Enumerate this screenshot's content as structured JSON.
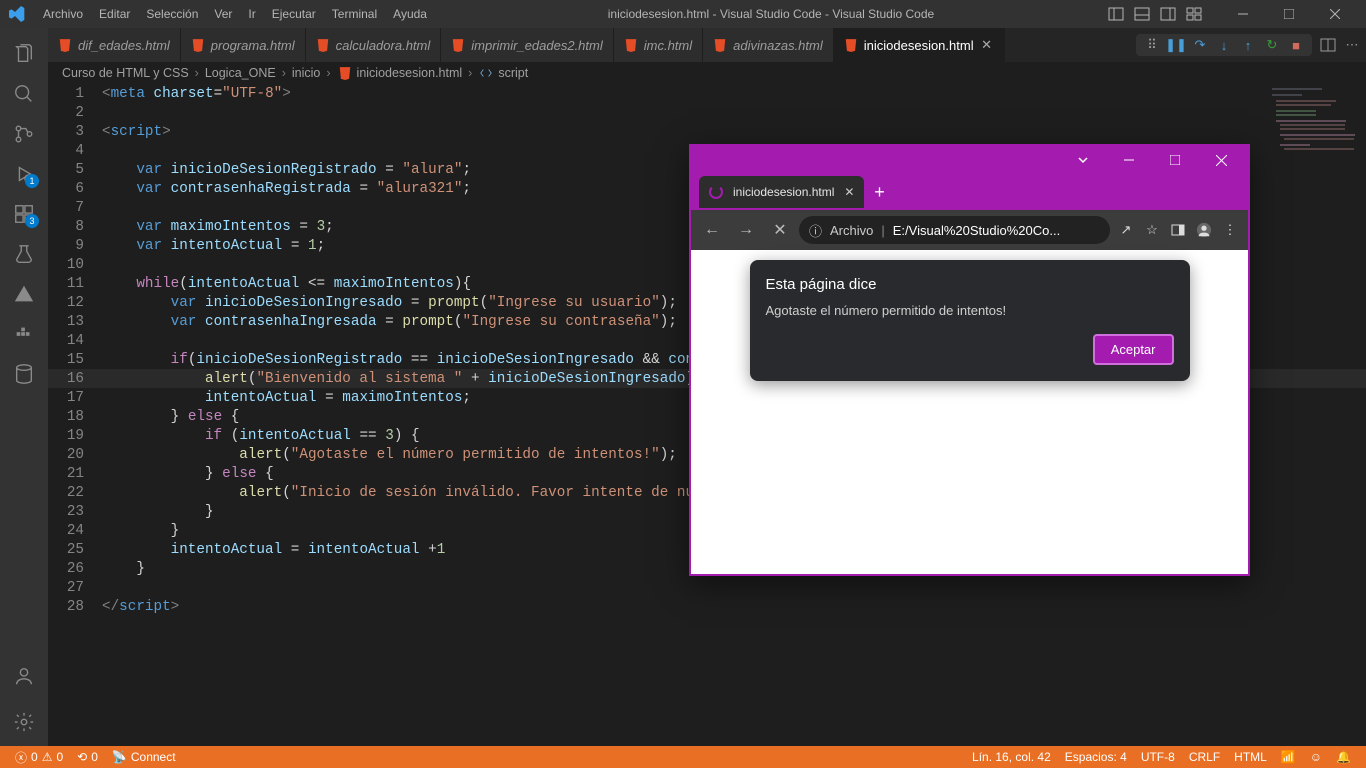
{
  "titlebar": {
    "menus": [
      "Archivo",
      "Editar",
      "Selección",
      "Ver",
      "Ir",
      "Ejecutar",
      "Terminal",
      "Ayuda"
    ],
    "title": "iniciodesesion.html - Visual Studio Code - Visual Studio Code"
  },
  "activity_badges": {
    "debug": "1",
    "ext": "3"
  },
  "tabs": [
    {
      "label": "dif_edades.html",
      "active": false
    },
    {
      "label": "programa.html",
      "active": false
    },
    {
      "label": "calculadora.html",
      "active": false
    },
    {
      "label": "imprimir_edades2.html",
      "active": false
    },
    {
      "label": "imc.html",
      "active": false
    },
    {
      "label": "adivinazas.html",
      "active": false
    },
    {
      "label": "iniciodesesion.html",
      "active": true
    }
  ],
  "breadcrumb": {
    "parts": [
      "Curso de HTML y CSS",
      "Logica_ONE",
      "inicio",
      "iniciodesesion.html",
      "script"
    ]
  },
  "code": {
    "current_line": 16,
    "lines": [
      [
        [
          "tag",
          "<"
        ],
        [
          "tagname",
          "meta"
        ],
        [
          "plain",
          " "
        ],
        [
          "attr",
          "charset"
        ],
        [
          "op",
          "="
        ],
        [
          "str",
          "\"UTF-8\""
        ],
        [
          "tag",
          ">"
        ]
      ],
      [],
      [
        [
          "tag",
          "<"
        ],
        [
          "tagname",
          "script"
        ],
        [
          "tag",
          ">"
        ]
      ],
      [],
      [
        [
          "plain",
          "    "
        ],
        [
          "kw",
          "var"
        ],
        [
          "plain",
          " "
        ],
        [
          "var",
          "inicioDeSesionRegistrado"
        ],
        [
          "plain",
          " "
        ],
        [
          "op",
          "="
        ],
        [
          "plain",
          " "
        ],
        [
          "str",
          "\"alura\""
        ],
        [
          "op",
          ";"
        ]
      ],
      [
        [
          "plain",
          "    "
        ],
        [
          "kw",
          "var"
        ],
        [
          "plain",
          " "
        ],
        [
          "var",
          "contrasenhaRegistrada"
        ],
        [
          "plain",
          " "
        ],
        [
          "op",
          "="
        ],
        [
          "plain",
          " "
        ],
        [
          "str",
          "\"alura321\""
        ],
        [
          "op",
          ";"
        ]
      ],
      [],
      [
        [
          "plain",
          "    "
        ],
        [
          "kw",
          "var"
        ],
        [
          "plain",
          " "
        ],
        [
          "var",
          "maximoIntentos"
        ],
        [
          "plain",
          " "
        ],
        [
          "op",
          "="
        ],
        [
          "plain",
          " "
        ],
        [
          "num",
          "3"
        ],
        [
          "op",
          ";"
        ]
      ],
      [
        [
          "plain",
          "    "
        ],
        [
          "kw",
          "var"
        ],
        [
          "plain",
          " "
        ],
        [
          "var",
          "intentoActual"
        ],
        [
          "plain",
          " "
        ],
        [
          "op",
          "="
        ],
        [
          "plain",
          " "
        ],
        [
          "num",
          "1"
        ],
        [
          "op",
          ";"
        ]
      ],
      [],
      [
        [
          "plain",
          "    "
        ],
        [
          "kw2",
          "while"
        ],
        [
          "op",
          "("
        ],
        [
          "var",
          "intentoActual"
        ],
        [
          "plain",
          " "
        ],
        [
          "op",
          "<="
        ],
        [
          "plain",
          " "
        ],
        [
          "var",
          "maximoIntentos"
        ],
        [
          "op",
          "){"
        ]
      ],
      [
        [
          "plain",
          "        "
        ],
        [
          "kw",
          "var"
        ],
        [
          "plain",
          " "
        ],
        [
          "var",
          "inicioDeSesionIngresado"
        ],
        [
          "plain",
          " "
        ],
        [
          "op",
          "="
        ],
        [
          "plain",
          " "
        ],
        [
          "fn",
          "prompt"
        ],
        [
          "op",
          "("
        ],
        [
          "str",
          "\"Ingrese su usuario\""
        ],
        [
          "op",
          ");"
        ]
      ],
      [
        [
          "plain",
          "        "
        ],
        [
          "kw",
          "var"
        ],
        [
          "plain",
          " "
        ],
        [
          "var",
          "contrasenhaIngresada"
        ],
        [
          "plain",
          " "
        ],
        [
          "op",
          "="
        ],
        [
          "plain",
          " "
        ],
        [
          "fn",
          "prompt"
        ],
        [
          "op",
          "("
        ],
        [
          "str",
          "\"Ingrese su contraseña\""
        ],
        [
          "op",
          ");"
        ]
      ],
      [],
      [
        [
          "plain",
          "        "
        ],
        [
          "kw2",
          "if"
        ],
        [
          "op",
          "("
        ],
        [
          "var",
          "inicioDeSesionRegistrado"
        ],
        [
          "plain",
          " "
        ],
        [
          "op",
          "=="
        ],
        [
          "plain",
          " "
        ],
        [
          "var",
          "inicioDeSesionIngresado"
        ],
        [
          "plain",
          " "
        ],
        [
          "op",
          "&&"
        ],
        [
          "plain",
          " "
        ],
        [
          "var",
          "contrasen"
        ]
      ],
      [
        [
          "plain",
          "            "
        ],
        [
          "fn",
          "alert"
        ],
        [
          "op",
          "("
        ],
        [
          "str",
          "\"Bienvenido al sistema \""
        ],
        [
          "plain",
          " "
        ],
        [
          "op",
          "+"
        ],
        [
          "plain",
          " "
        ],
        [
          "var",
          "inicioDeSesionIngresado"
        ],
        [
          "op",
          ");"
        ]
      ],
      [
        [
          "plain",
          "            "
        ],
        [
          "var",
          "intentoActual"
        ],
        [
          "plain",
          " "
        ],
        [
          "op",
          "="
        ],
        [
          "plain",
          " "
        ],
        [
          "var",
          "maximoIntentos"
        ],
        [
          "op",
          ";"
        ]
      ],
      [
        [
          "plain",
          "        "
        ],
        [
          "op",
          "}"
        ],
        [
          "plain",
          " "
        ],
        [
          "kw2",
          "else"
        ],
        [
          "plain",
          " "
        ],
        [
          "op",
          "{"
        ]
      ],
      [
        [
          "plain",
          "            "
        ],
        [
          "kw2",
          "if"
        ],
        [
          "plain",
          " "
        ],
        [
          "op",
          "("
        ],
        [
          "var",
          "intentoActual"
        ],
        [
          "plain",
          " "
        ],
        [
          "op",
          "=="
        ],
        [
          "plain",
          " "
        ],
        [
          "num",
          "3"
        ],
        [
          "op",
          ")"
        ],
        [
          "plain",
          " "
        ],
        [
          "op",
          "{"
        ]
      ],
      [
        [
          "plain",
          "                "
        ],
        [
          "fn",
          "alert"
        ],
        [
          "op",
          "("
        ],
        [
          "str",
          "\"Agotaste el número permitido de intentos!\""
        ],
        [
          "op",
          ");"
        ]
      ],
      [
        [
          "plain",
          "            "
        ],
        [
          "op",
          "}"
        ],
        [
          "plain",
          " "
        ],
        [
          "kw2",
          "else"
        ],
        [
          "plain",
          " "
        ],
        [
          "op",
          "{"
        ]
      ],
      [
        [
          "plain",
          "                "
        ],
        [
          "fn",
          "alert"
        ],
        [
          "op",
          "("
        ],
        [
          "str",
          "\"Inicio de sesión inválido. Favor intente de nuevo\""
        ],
        [
          "op",
          ");"
        ]
      ],
      [
        [
          "plain",
          "            "
        ],
        [
          "op",
          "}"
        ]
      ],
      [
        [
          "plain",
          "        "
        ],
        [
          "op",
          "}"
        ]
      ],
      [
        [
          "plain",
          "        "
        ],
        [
          "var",
          "intentoActual"
        ],
        [
          "plain",
          " "
        ],
        [
          "op",
          "="
        ],
        [
          "plain",
          " "
        ],
        [
          "var",
          "intentoActual"
        ],
        [
          "plain",
          " "
        ],
        [
          "op",
          "+"
        ],
        [
          "num",
          "1"
        ]
      ],
      [
        [
          "plain",
          "    "
        ],
        [
          "op",
          "}"
        ]
      ],
      [],
      [
        [
          "tag",
          "</"
        ],
        [
          "tagname",
          "script"
        ],
        [
          "tag",
          ">"
        ]
      ]
    ]
  },
  "statusbar": {
    "errors": "0",
    "warnings": "0",
    "port": "0",
    "connect": "Connect",
    "pos": "Lín. 16, col. 42",
    "spaces": "Espacios: 4",
    "encoding": "UTF-8",
    "eol": "CRLF",
    "lang": "HTML"
  },
  "browser": {
    "tab_title": "iniciodesesion.html",
    "url_label": "Archivo",
    "url": "E:/Visual%20Studio%20Co...",
    "dialog": {
      "title": "Esta página dice",
      "message": "Agotaste el número permitido de intentos!",
      "button": "Aceptar"
    }
  }
}
